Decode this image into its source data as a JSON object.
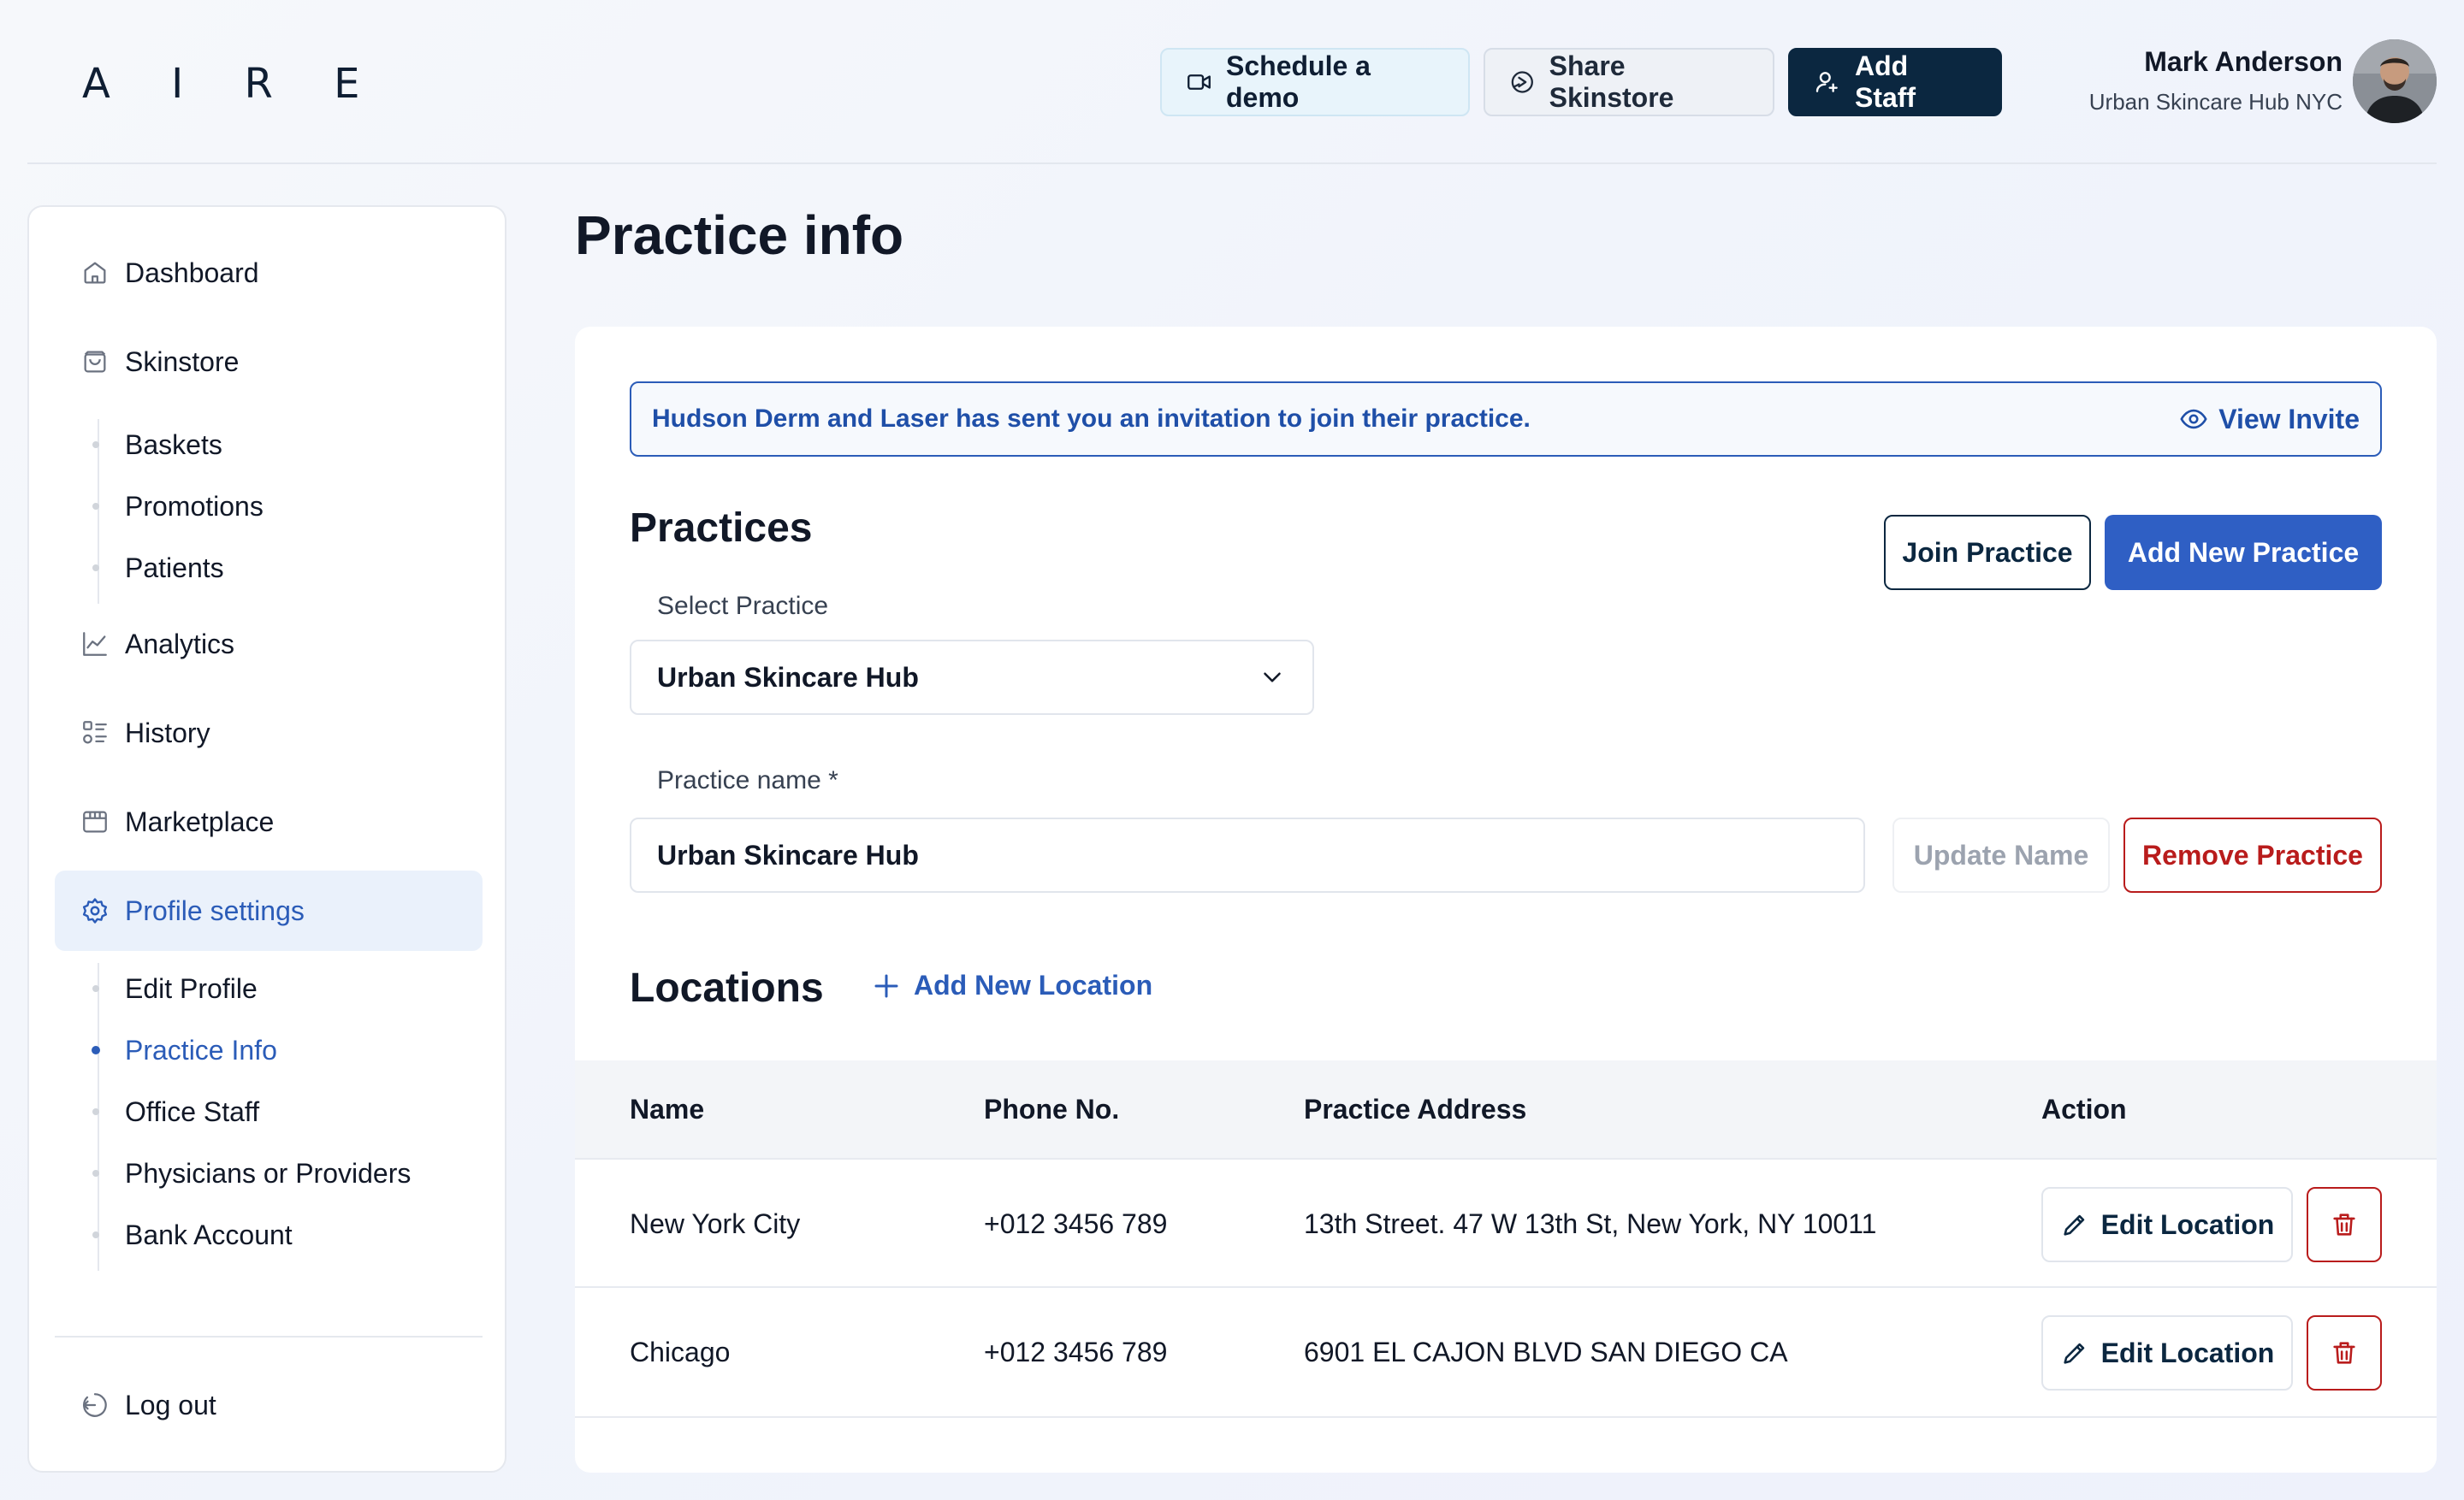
{
  "header": {
    "logo": "A I R E",
    "schedule_demo": "Schedule a demo",
    "share_skinstore": "Share Skinstore",
    "add_staff": "Add Staff",
    "user_name": "Mark Anderson",
    "user_org": "Urban Skincare Hub NYC"
  },
  "sidebar": {
    "items": [
      {
        "label": "Dashboard",
        "icon": "home-icon"
      },
      {
        "label": "Skinstore",
        "icon": "bag-icon"
      },
      {
        "label": "Analytics",
        "icon": "chart-icon"
      },
      {
        "label": "History",
        "icon": "list-icon"
      },
      {
        "label": "Marketplace",
        "icon": "store-icon"
      },
      {
        "label": "Profile settings",
        "icon": "gear-icon"
      }
    ],
    "skinstore_sub": [
      "Baskets",
      "Promotions",
      "Patients"
    ],
    "profile_sub": [
      "Edit Profile",
      "Practice Info",
      "Office Staff",
      "Physicians or Providers",
      "Bank Account"
    ],
    "active_sub": "Practice Info",
    "logout": "Log out"
  },
  "main": {
    "title": "Practice info",
    "invite_text": "Hudson Derm and Laser has sent you an invitation to join their practice.",
    "view_invite": "View Invite",
    "practices_title": "Practices",
    "join_practice": "Join Practice",
    "add_new_practice": "Add New Practice",
    "select_label": "Select Practice",
    "select_value": "Urban Skincare Hub",
    "name_label": "Practice name *",
    "name_value": "Urban Skincare Hub",
    "update_name": "Update Name",
    "remove_practice": "Remove Practice",
    "locations_title": "Locations",
    "add_location": "Add New Location",
    "table": {
      "headers": [
        "Name",
        "Phone No.",
        "Practice Address",
        "Action"
      ],
      "edit_label": "Edit Location",
      "rows": [
        {
          "name": "New York City",
          "phone": "+012 3456 789",
          "address": "13th Street. 47 W 13th St, New York, NY 10011"
        },
        {
          "name": "Chicago",
          "phone": "+012 3456 789",
          "address": "6901 EL CAJON BLVD SAN DIEGO CA"
        }
      ]
    }
  },
  "colors": {
    "primary": "#2f5fc4",
    "navy": "#0b2740",
    "danger": "#b91c1c"
  }
}
